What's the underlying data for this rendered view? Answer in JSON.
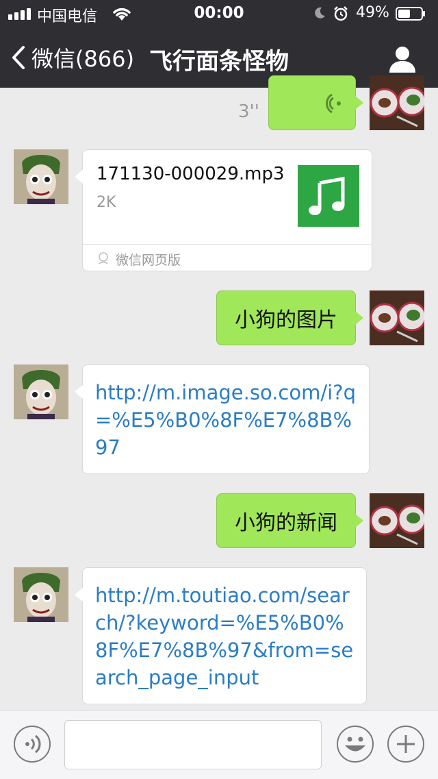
{
  "status": {
    "carrier": "中国电信",
    "time": "00:00",
    "battery": "49%"
  },
  "nav": {
    "back_label": "微信(866)",
    "title": "飞行面条怪物"
  },
  "messages": [
    {
      "type": "voice",
      "side": "right",
      "duration": "3''"
    },
    {
      "type": "file",
      "side": "left",
      "file_name": "171130-000029.mp3",
      "file_size": "2K",
      "source": "微信网页版",
      "battery_level": 0.49
    },
    {
      "type": "text",
      "side": "right",
      "text": "小狗的图片"
    },
    {
      "type": "link",
      "side": "left",
      "text": "http://m.image.so.com/i?q=%E5%B0%8F%E7%8B%97"
    },
    {
      "type": "text",
      "side": "right",
      "text": "小狗的新闻"
    },
    {
      "type": "link",
      "side": "left",
      "text": "http://m.toutiao.com/search/?keyword=%E5%B0%8F%E7%8B%97&from=search_page_input"
    }
  ],
  "input": {
    "value": "",
    "placeholder": ""
  },
  "colors": {
    "nav_bg": "#2e2e33",
    "sent_bubble": "#a0e75a",
    "link": "#2a7dc5",
    "file_icon_bg": "#2ca743"
  },
  "icons": [
    "signal-icon",
    "wifi-icon",
    "moon-icon",
    "alarm-icon",
    "battery-icon",
    "back-chevron-icon",
    "profile-icon",
    "voice-wave-icon",
    "music-note-icon",
    "voice-mode-icon",
    "emoji-icon",
    "plus-icon"
  ]
}
